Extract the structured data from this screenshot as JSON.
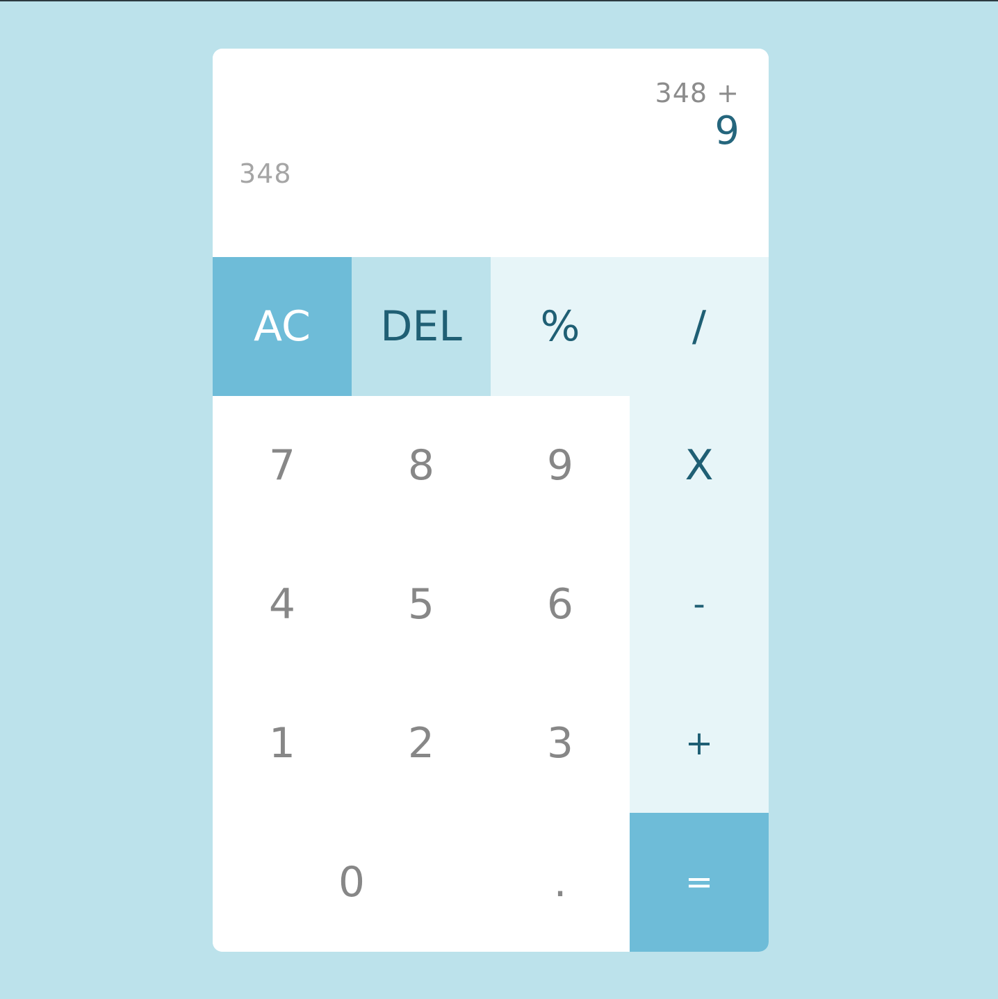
{
  "display": {
    "previous_operand": "348 +",
    "current_operand": "9",
    "running_value": "348"
  },
  "keys": {
    "ac": "AC",
    "del": "DEL",
    "percent": "%",
    "divide": "/",
    "seven": "7",
    "eight": "8",
    "nine": "9",
    "multiply": "X",
    "four": "4",
    "five": "5",
    "six": "6",
    "subtract": "-",
    "one": "1",
    "two": "2",
    "three": "3",
    "add": "+",
    "zero": "0",
    "decimal": ".",
    "equals": "="
  },
  "colors": {
    "page_background": "#bce2eb",
    "accent": "#6ebcd8",
    "operator_background": "#e7f5f8",
    "operator_text": "#1f5f74",
    "digit_text": "#878787"
  }
}
